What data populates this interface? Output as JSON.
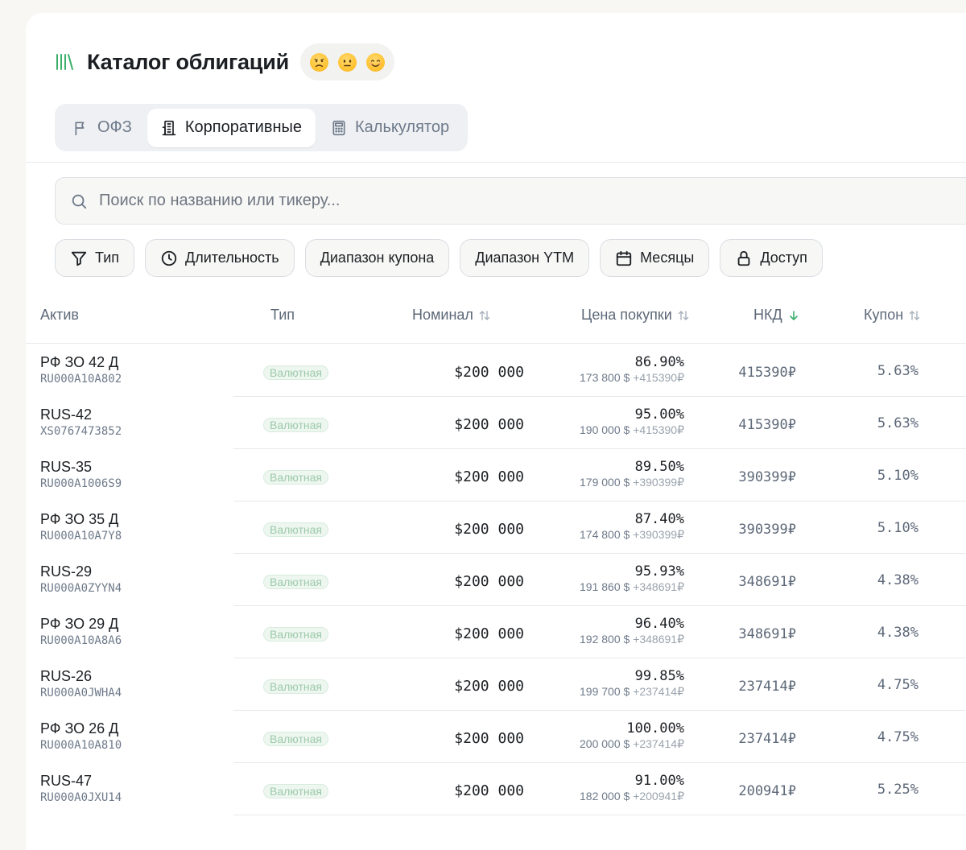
{
  "app": {
    "title": "Каталог облигаций",
    "emojis": [
      "disappointed",
      "neutral",
      "smiling"
    ]
  },
  "tabs": [
    {
      "label": "ОФЗ",
      "icon": "flag-icon",
      "active": false
    },
    {
      "label": "Корпоративные",
      "icon": "building-icon",
      "active": true
    },
    {
      "label": "Калькулятор",
      "icon": "calculator-icon",
      "active": false
    }
  ],
  "search": {
    "placeholder": "Поиск по названию или тикеру...",
    "value": ""
  },
  "filters": [
    {
      "label": "Тип",
      "icon": "filter-icon"
    },
    {
      "label": "Длительность",
      "icon": "clock-icon"
    },
    {
      "label": "Диапазон купона",
      "icon": ""
    },
    {
      "label": "Диапазон YTM",
      "icon": ""
    },
    {
      "label": "Месяцы",
      "icon": "calendar-icon"
    },
    {
      "label": "Доступ",
      "icon": "lock-icon"
    }
  ],
  "table": {
    "columns": {
      "asset": "Актив",
      "type": "Тип",
      "nominal": "Номинал",
      "price": "Цена покупки",
      "nkd": "НКД",
      "coupon": "Купон"
    },
    "sort": {
      "column": "nkd",
      "direction": "desc"
    },
    "rows": [
      {
        "name": "РФ ЗО 42 Д",
        "ticker": "RU000A10A802",
        "type": "Валютная",
        "nominal": "$200 000",
        "price_pct": "86.90%",
        "price_amount": "173 800 $",
        "price_extra": "+415390₽",
        "nkd": "415390₽",
        "coupon": "5.63%"
      },
      {
        "name": "RUS-42",
        "ticker": "XS0767473852",
        "type": "Валютная",
        "nominal": "$200 000",
        "price_pct": "95.00%",
        "price_amount": "190 000 $",
        "price_extra": "+415390₽",
        "nkd": "415390₽",
        "coupon": "5.63%"
      },
      {
        "name": "RUS-35",
        "ticker": "RU000A1006S9",
        "type": "Валютная",
        "nominal": "$200 000",
        "price_pct": "89.50%",
        "price_amount": "179 000 $",
        "price_extra": "+390399₽",
        "nkd": "390399₽",
        "coupon": "5.10%"
      },
      {
        "name": "РФ ЗО 35 Д",
        "ticker": "RU000A10A7Y8",
        "type": "Валютная",
        "nominal": "$200 000",
        "price_pct": "87.40%",
        "price_amount": "174 800 $",
        "price_extra": "+390399₽",
        "nkd": "390399₽",
        "coupon": "5.10%"
      },
      {
        "name": "RUS-29",
        "ticker": "RU000A0ZYYN4",
        "type": "Валютная",
        "nominal": "$200 000",
        "price_pct": "95.93%",
        "price_amount": "191 860 $",
        "price_extra": "+348691₽",
        "nkd": "348691₽",
        "coupon": "4.38%"
      },
      {
        "name": "РФ ЗО 29 Д",
        "ticker": "RU000A10A8A6",
        "type": "Валютная",
        "nominal": "$200 000",
        "price_pct": "96.40%",
        "price_amount": "192 800 $",
        "price_extra": "+348691₽",
        "nkd": "348691₽",
        "coupon": "4.38%"
      },
      {
        "name": "RUS-26",
        "ticker": "RU000A0JWHA4",
        "type": "Валютная",
        "nominal": "$200 000",
        "price_pct": "99.85%",
        "price_amount": "199 700 $",
        "price_extra": "+237414₽",
        "nkd": "237414₽",
        "coupon": "4.75%"
      },
      {
        "name": "РФ ЗО 26 Д",
        "ticker": "RU000A10A810",
        "type": "Валютная",
        "nominal": "$200 000",
        "price_pct": "100.00%",
        "price_amount": "200 000 $",
        "price_extra": "+237414₽",
        "nkd": "237414₽",
        "coupon": "4.75%"
      },
      {
        "name": "RUS-47",
        "ticker": "RU000A0JXU14",
        "type": "Валютная",
        "nominal": "$200 000",
        "price_pct": "91.00%",
        "price_amount": "182 000 $",
        "price_extra": "+200941₽",
        "nkd": "200941₽",
        "coupon": "5.25%"
      }
    ]
  },
  "colors": {
    "accent": "#3aae6a",
    "badge_text": "#9ccaaa",
    "muted": "#6e7a8a"
  }
}
